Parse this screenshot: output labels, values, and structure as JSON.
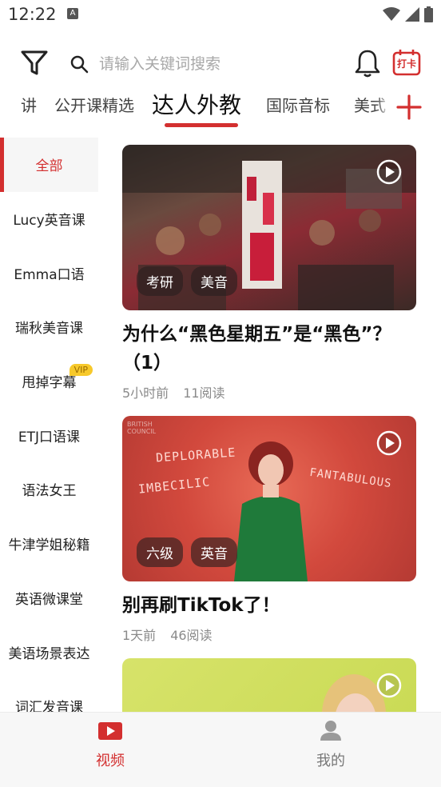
{
  "status_bar": {
    "time": "12:22",
    "notification_letter": "A"
  },
  "header": {
    "search_placeholder": "请输入关键词搜索",
    "checkin_label": "打卡"
  },
  "tabs": [
    {
      "label": "讲"
    },
    {
      "label": "公开课精选"
    },
    {
      "label": "达人外教",
      "active": true
    },
    {
      "label": "国际音标"
    },
    {
      "label": "美式"
    }
  ],
  "sidebar": {
    "items": [
      {
        "label": "全部",
        "active": true
      },
      {
        "label": "Lucy英音课"
      },
      {
        "label": "Emma口语"
      },
      {
        "label": "瑞秋美音课"
      },
      {
        "label": "甩掉字幕",
        "badge": "VIP"
      },
      {
        "label": "ETJ口语课"
      },
      {
        "label": "语法女王"
      },
      {
        "label": "牛津学姐秘籍"
      },
      {
        "label": "英语微课堂"
      },
      {
        "label": "美语场景表达"
      },
      {
        "label": "词汇发音课"
      }
    ]
  },
  "feed": [
    {
      "tags": [
        "考研",
        "美音"
      ],
      "title": "为什么“黑色星期五”是“黑色”？（1）",
      "time": "5小时前",
      "reads": "11阅读"
    },
    {
      "tags": [
        "六级",
        "英音"
      ],
      "title": "别再刷TikTok了！",
      "time": "1天前",
      "reads": "46阅读",
      "overlay_words": [
        "DEPLORABLE",
        "IMBECILIC",
        "FANTABULOUS"
      ],
      "logo_text": "BRITISH COUNCIL"
    },
    {
      "tags": [],
      "title": "",
      "time": "",
      "reads": ""
    }
  ],
  "bottom_nav": {
    "items": [
      {
        "label": "视频",
        "active": true
      },
      {
        "label": "我的"
      }
    ]
  },
  "colors": {
    "accent": "#d32f2f",
    "vip": "#f7c92b"
  }
}
